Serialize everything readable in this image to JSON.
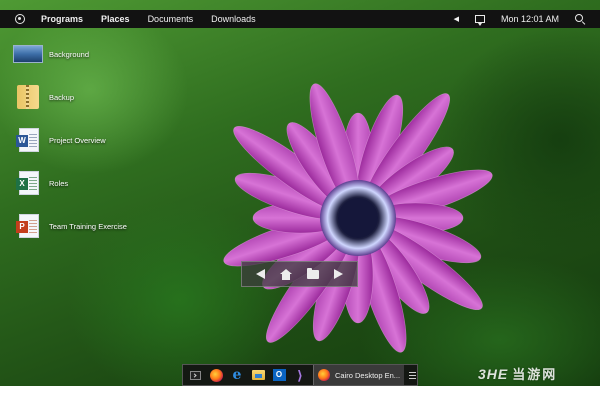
{
  "top_panel": {
    "menu": [
      "Programs",
      "Places",
      "Documents",
      "Downloads"
    ],
    "clock": "Mon 12:01 AM",
    "icons": [
      "cairo-logo-icon",
      "left-arrow-icon",
      "notification-icon",
      "search-icon"
    ]
  },
  "desktop_icons": [
    {
      "label": "Background",
      "icon": "image-icon"
    },
    {
      "label": "Backup",
      "icon": "zip-folder-icon"
    },
    {
      "label": "Project Overview",
      "icon": "word-doc-icon",
      "badge": "W"
    },
    {
      "label": "Roles",
      "icon": "excel-doc-icon",
      "badge": "X"
    },
    {
      "label": "Team Training Exercise",
      "icon": "powerpoint-doc-icon",
      "badge": "P"
    }
  ],
  "nav_widget": {
    "icons": [
      "back-icon",
      "home-icon",
      "folder-icon",
      "forward-icon"
    ]
  },
  "dock": {
    "apps": [
      "terminal-icon",
      "firefox-icon",
      "edge-icon",
      "file-explorer-icon",
      "outlook-icon",
      "visual-studio-icon"
    ],
    "task_label": "Cairo Desktop En...",
    "outlook_letter": "O",
    "edge_letter": "e",
    "vs_letter": "⟩"
  },
  "watermark": {
    "brand": "3HE",
    "sub": "当游网"
  },
  "colors": {
    "panel_bg": "#121212",
    "petal": "#c44fc0",
    "petal_light": "#e3a0e0",
    "flower_center": "#1b1d3d",
    "word_blue": "#2b5797",
    "excel_green": "#1e7145",
    "ppt_red": "#c43e1c"
  }
}
